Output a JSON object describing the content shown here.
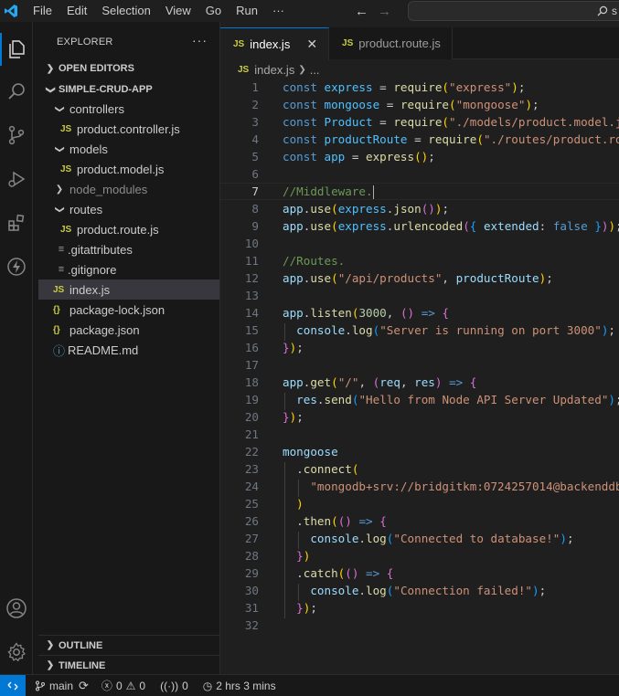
{
  "menu": [
    "File",
    "Edit",
    "Selection",
    "View",
    "Go",
    "Run",
    "···"
  ],
  "nav": {
    "back": "←",
    "forward": "→",
    "search_text": "s"
  },
  "explorer": {
    "title": "EXPLORER",
    "more": "···",
    "open_editors": "OPEN EDITORS",
    "project": "SIMPLE-CRUD-APP",
    "items": [
      {
        "label": "controllers"
      },
      {
        "label": "product.controller.js"
      },
      {
        "label": "models"
      },
      {
        "label": "product.model.js"
      },
      {
        "label": "node_modules"
      },
      {
        "label": "routes"
      },
      {
        "label": "product.route.js"
      },
      {
        "label": ".gitattributes"
      },
      {
        "label": ".gitignore"
      },
      {
        "label": "index.js"
      },
      {
        "label": "package-lock.json"
      },
      {
        "label": "package.json"
      },
      {
        "label": "README.md"
      }
    ],
    "outline": "OUTLINE",
    "timeline": "TIMELINE"
  },
  "tabs": [
    {
      "label": "index.js",
      "close": "✕"
    },
    {
      "label": "product.route.js"
    }
  ],
  "breadcrumb": {
    "file": "index.js",
    "rest": "..."
  },
  "editor": {
    "current_line": 7
  },
  "status": {
    "branch": "main",
    "errors": "0",
    "warnings": "0",
    "ports": "0",
    "time": "2 hrs 3 mins"
  },
  "colors": {
    "accent": "#0078d4",
    "string": "#ce9178",
    "keyword": "#569cd6",
    "variable": "#4fc1ff",
    "function": "#dcdcaa",
    "comment": "#6a9955"
  }
}
